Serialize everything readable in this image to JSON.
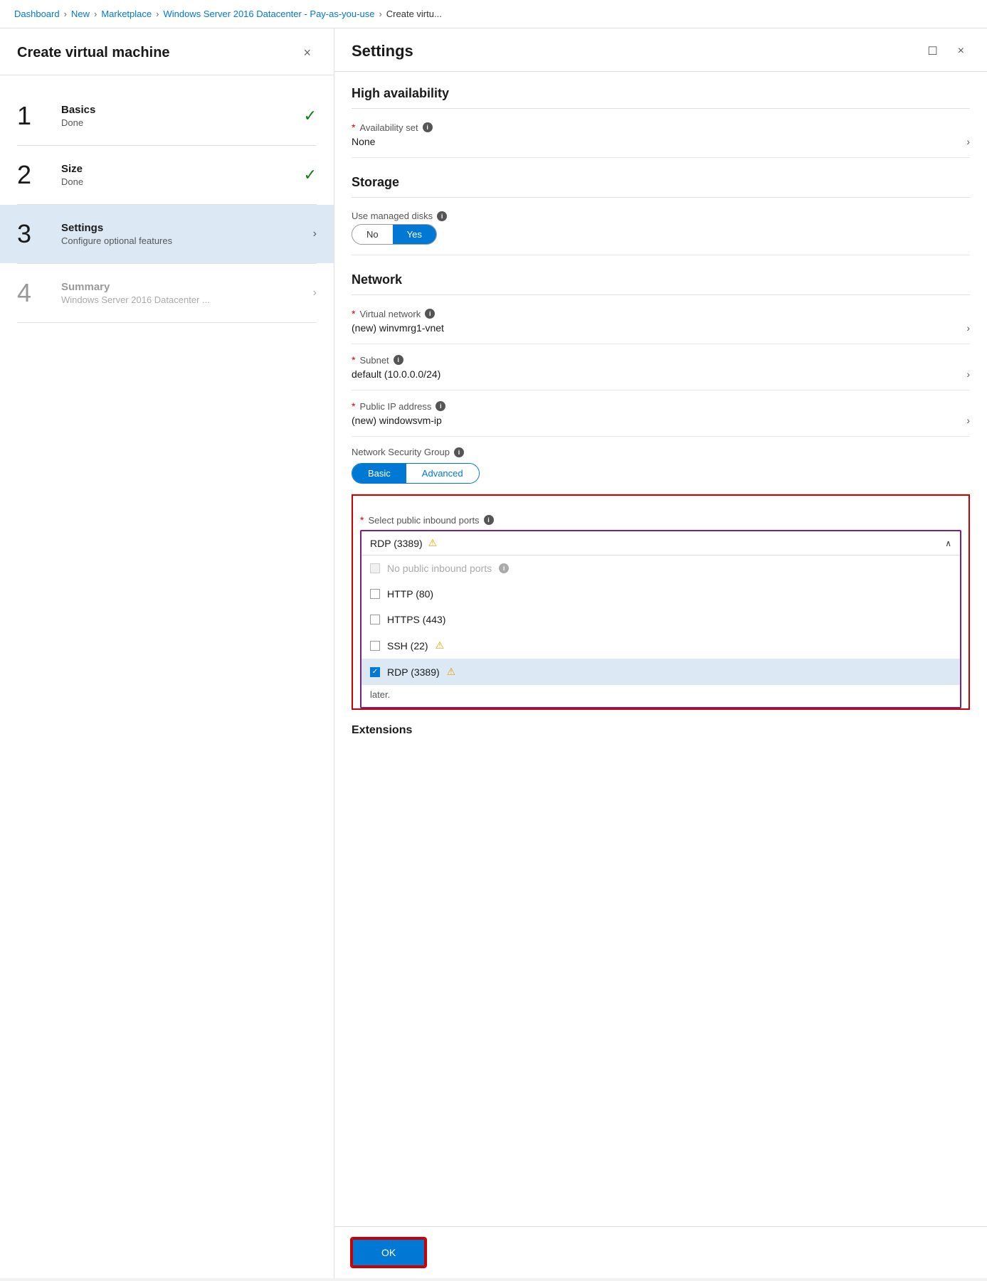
{
  "breadcrumb": {
    "items": [
      "Dashboard",
      "New",
      "Marketplace",
      "Windows Server 2016 Datacenter - Pay-as-you-use",
      "Create virtu..."
    ]
  },
  "left_panel": {
    "title": "Create virtual machine",
    "close_label": "×",
    "steps": [
      {
        "number": "1",
        "title": "Basics",
        "subtitle": "Done",
        "state": "done",
        "has_check": true,
        "has_chevron": false
      },
      {
        "number": "2",
        "title": "Size",
        "subtitle": "Done",
        "state": "done",
        "has_check": true,
        "has_chevron": false
      },
      {
        "number": "3",
        "title": "Settings",
        "subtitle": "Configure optional features",
        "state": "active",
        "has_check": false,
        "has_chevron": true
      },
      {
        "number": "4",
        "title": "Summary",
        "subtitle": "Windows Server 2016 Datacenter ...",
        "state": "inactive",
        "has_check": false,
        "has_chevron": true
      }
    ]
  },
  "right_panel": {
    "title": "Settings",
    "sections": {
      "high_availability": {
        "label": "High availability",
        "availability_set": {
          "label": "Availability set",
          "value": "None",
          "required": true
        }
      },
      "storage": {
        "label": "Storage",
        "managed_disks": {
          "label": "Use managed disks",
          "options": [
            "No",
            "Yes"
          ],
          "selected": "Yes"
        }
      },
      "network": {
        "label": "Network",
        "virtual_network": {
          "label": "Virtual network",
          "value": "(new) winvmrg1-vnet",
          "required": true
        },
        "subnet": {
          "label": "Subnet",
          "value": "default (10.0.0.0/24)",
          "required": true
        },
        "public_ip": {
          "label": "Public IP address",
          "value": "(new) windowsvm-ip",
          "required": true
        },
        "nsg": {
          "label": "Network Security Group",
          "options": [
            "Basic",
            "Advanced"
          ],
          "selected": "Basic"
        },
        "select_inbound": {
          "label": "Select public inbound ports",
          "required": true,
          "selected_value": "RDP (3389)",
          "warning": true
        }
      }
    },
    "dropdown": {
      "header": "RDP (3389)",
      "header_warning": true,
      "items": [
        {
          "label": "No public inbound ports",
          "checked": false,
          "disabled": true,
          "warning": false
        },
        {
          "label": "HTTP (80)",
          "checked": false,
          "disabled": false,
          "warning": false
        },
        {
          "label": "HTTPS (443)",
          "checked": false,
          "disabled": false,
          "warning": false
        },
        {
          "label": "SSH (22)",
          "checked": false,
          "disabled": false,
          "warning": true
        },
        {
          "label": "RDP (3389)",
          "checked": true,
          "disabled": false,
          "warning": true
        }
      ],
      "footer_text": "later.",
      "is_open": true
    },
    "extensions_label": "Extensions",
    "ok_label": "OK"
  }
}
